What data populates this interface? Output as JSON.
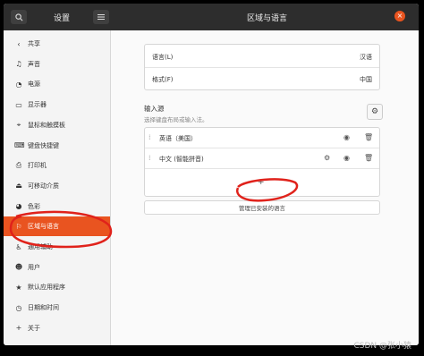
{
  "titlebar": {
    "search_icon": "search-icon",
    "app_title": "设置",
    "menu_icon": "menu-icon",
    "page_title": "区域与语言",
    "close_symbol": "×"
  },
  "sidebar": {
    "items": [
      {
        "icon": "‹",
        "label": "共享"
      },
      {
        "icon": "♫",
        "label": "声音"
      },
      {
        "icon": "◔",
        "label": "电源"
      },
      {
        "icon": "▭",
        "label": "显示器"
      },
      {
        "icon": "⌖",
        "label": "鼠标和触摸板"
      },
      {
        "icon": "⌨",
        "label": "键盘快捷键"
      },
      {
        "icon": "⎙",
        "label": "打印机"
      },
      {
        "icon": "⏏",
        "label": "可移动介质"
      },
      {
        "icon": "◕",
        "label": "色彩"
      },
      {
        "icon": "⚐",
        "label": "区域与语言"
      },
      {
        "icon": "♿",
        "label": "通用辅助"
      },
      {
        "icon": "☻",
        "label": "用户"
      },
      {
        "icon": "★",
        "label": "默认应用程序"
      },
      {
        "icon": "◷",
        "label": "日期和时间"
      },
      {
        "icon": "+",
        "label": "关于"
      }
    ],
    "active_index": 9
  },
  "language": {
    "label": "语言(L)",
    "value": "汉语"
  },
  "formats": {
    "label": "格式(F)",
    "value": "中国"
  },
  "input_sources": {
    "title": "输入源",
    "subtitle": "选择键盘布局或输入法。",
    "items": [
      {
        "label": "英语（美国）"
      },
      {
        "label": "中文 (智能拼音)"
      }
    ],
    "add_symbol": "+"
  },
  "install_button": {
    "label": "管理已安装的语言"
  },
  "watermark": "CSDN @张小猿",
  "colors": {
    "accent": "#e95420",
    "annotation": "#e0221b"
  }
}
